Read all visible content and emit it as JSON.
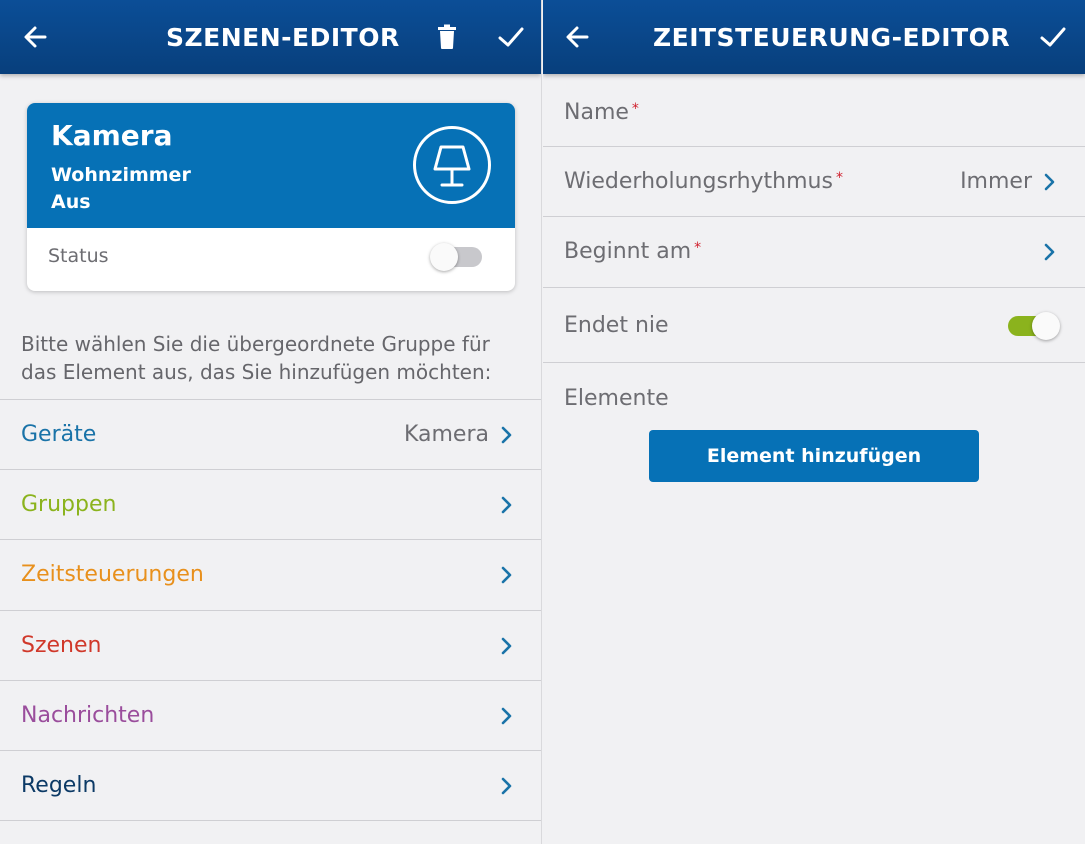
{
  "left": {
    "header": {
      "title": "SZENEN-EDITOR"
    },
    "card": {
      "title": "Kamera",
      "room": "Wohnzimmer",
      "state": "Aus",
      "status_label": "Status",
      "status_on": false,
      "icon": "lamp-icon"
    },
    "hint": "Bitte wählen Sie die übergeordnete Gruppe für das Element aus, das Sie hinzufügen möchten:",
    "groups": [
      {
        "label": "Geräte",
        "value": "Kamera",
        "color": "#1a73a8"
      },
      {
        "label": "Gruppen",
        "value": "",
        "color": "#8bb31d"
      },
      {
        "label": "Zeitsteuerungen",
        "value": "",
        "color": "#e8901c"
      },
      {
        "label": "Szenen",
        "value": "",
        "color": "#d0382a"
      },
      {
        "label": "Nachrichten",
        "value": "",
        "color": "#9a4d9c"
      },
      {
        "label": "Regeln",
        "value": "",
        "color": "#0c3a66"
      }
    ]
  },
  "right": {
    "header": {
      "title": "ZEITSTEUERUNG-EDITOR"
    },
    "fields": [
      {
        "label": "Name",
        "required": "*",
        "value": ""
      },
      {
        "label": "Wiederholungsrhythmus",
        "required": "*",
        "value": "Immer"
      },
      {
        "label": "Beginnt am",
        "required": "*",
        "value": ""
      }
    ],
    "ends_never": {
      "label": "Endet nie",
      "on": true
    },
    "elements_label": "Elemente",
    "add_button": "Element hinzufügen"
  },
  "colors": {
    "header": "#0b4e97",
    "accent": "#0671b6",
    "chevron": "#1a73a8",
    "toggle_on": "#8bb31d",
    "toggle_off": "#c8c8cc",
    "required": "#d0202d"
  }
}
